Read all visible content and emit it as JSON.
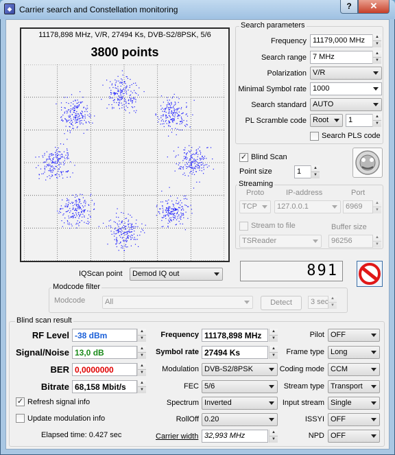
{
  "window": {
    "title": "Carrier search and Constellation monitoring",
    "help_label": "?",
    "close_label": "✕"
  },
  "plot": {
    "info_line": "11178,898 MHz, V/R, 27494 Ks, DVB-S2/8PSK, 5/6",
    "points_label": "3800 points",
    "dot_color": "#1a1aff"
  },
  "search_params": {
    "group_label": "Search parameters",
    "frequency_label": "Frequency",
    "frequency_value": "11179,000 MHz",
    "range_label": "Search range",
    "range_value": "7 MHz",
    "polarization_label": "Polarization",
    "polarization_value": "V/R",
    "min_symbol_label": "Minimal Symbol rate",
    "min_symbol_value": "1000",
    "standard_label": "Search standard",
    "standard_value": "AUTO",
    "pl_scramble_label": "PL Scramble code",
    "pl_scramble_mode": "Root",
    "pl_scramble_value": "1",
    "search_pls_label": "Search PLS code"
  },
  "blind_scan": {
    "label": "Blind Scan",
    "point_size_label": "Point size",
    "point_size_value": "1"
  },
  "streaming": {
    "label": "Streaming",
    "proto_label": "Proto",
    "ip_label": "IP-address",
    "port_label": "Port",
    "proto_value": "TCP",
    "ip_value": "127.0.0.1",
    "port_value": "6969",
    "stream_to_file_label": "Stream to file",
    "buffer_label": "Buffer size",
    "file_target": "TSReader",
    "buffer_value": "96256"
  },
  "lcd_value": "891",
  "iqscan": {
    "label": "IQScan point",
    "value": "Demod IQ out"
  },
  "modcode": {
    "group_label": "Modcode filter",
    "label": "Modcode",
    "value": "All",
    "detect_label": "Detect",
    "interval_value": "3 sec"
  },
  "result": {
    "group_label": "Blind scan result",
    "rf_level_label": "RF Level",
    "rf_level_value": "-38 dBm",
    "rf_color": "#1a5fd8",
    "snr_label": "Signal/Noise",
    "snr_value": "13,0 dB",
    "snr_color": "#1a8a1a",
    "ber_label": "BER",
    "ber_value": "0,0000000",
    "ber_color": "#e00000",
    "bitrate_label": "Bitrate",
    "bitrate_value": "68,158 Mbit/s",
    "freq_label": "Frequency",
    "freq_value": "11178,898 MHz",
    "symrate_label": "Symbol rate",
    "symrate_value": "27494 Ks",
    "modulation_label": "Modulation",
    "modulation_value": "DVB-S2/8PSK",
    "fec_label": "FEC",
    "fec_value": "5/6",
    "spectrum_label": "Spectrum",
    "spectrum_value": "Inverted",
    "rolloff_label": "RollOff",
    "rolloff_value": "0.20",
    "carrier_width_label": "Carrier width",
    "carrier_width_value": "32,993 MHz",
    "pilot_label": "Pilot",
    "pilot_value": "OFF",
    "frame_label": "Frame type",
    "frame_value": "Long",
    "coding_label": "Coding mode",
    "coding_value": "CCM",
    "stream_type_label": "Stream type",
    "stream_type_value": "Transport",
    "input_stream_label": "Input stream",
    "input_stream_value": "Single",
    "issyi_label": "ISSYI",
    "issyi_value": "OFF",
    "npd_label": "NPD",
    "npd_value": "OFF",
    "refresh_label": "Refresh signal info",
    "update_mod_label": "Update modulation info",
    "elapsed_label": "Elapsed time: 0.427 sec"
  }
}
